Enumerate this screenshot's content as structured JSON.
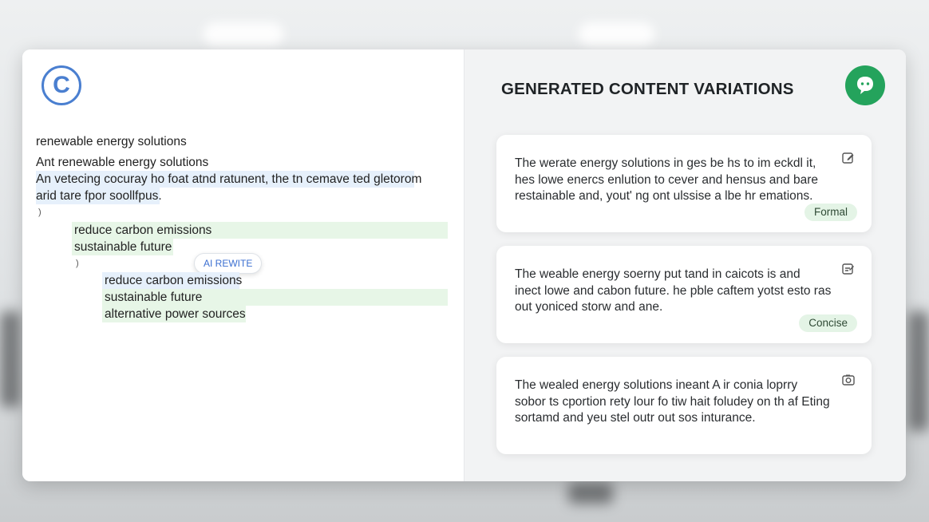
{
  "editor": {
    "logo_letter": "C",
    "lines": [
      "renewable energy solutions",
      "Ant renewable energy solutions",
      "An vetecing cocuray ho foat atnd ratunent, the tn cemave ted gletorom",
      "arid tare fpor soollfpus.",
      "reduce carbon emissions",
      "sustainable future",
      "reduce carbon emissions",
      "sustainable future",
      "alternative power sources"
    ],
    "brackets": [
      ")",
      ")"
    ],
    "ai_rewrite_label": "AI REWITE"
  },
  "variations": {
    "title": "GENERATED CONTENT VARIATIONS",
    "cards": [
      {
        "lines": [
          "The werate energy solutions in ges be hs to im eckdl it,",
          "hes lowe enercs enlution to cever and hensus and bare",
          "restainable and, yout' ng ont ulssise a lbe hr emations."
        ],
        "tag": "Formal",
        "icon": "edit-icon"
      },
      {
        "lines": [
          "The weable energy soerny put tand in caicots is and",
          "inect lowe and cabon future. he pble caftem yotst esto ras",
          "out yoniced storw and ane."
        ],
        "tag": "Concise",
        "icon": "edit-icon"
      },
      {
        "lines": [
          "The wealed energy solutions ineant A ir conia loprry",
          "sobor ts cportion rety lour fo tiw hait foludey on th af Eting",
          "sortamd and yeu stel outr out sos inturance."
        ],
        "tag": "",
        "icon": "camera-icon"
      }
    ]
  },
  "colors": {
    "accent_blue": "#4a7fd0",
    "accent_green": "#24a35c",
    "highlight_blue": "#e6f0fb",
    "highlight_green": "#e7f6e7"
  }
}
